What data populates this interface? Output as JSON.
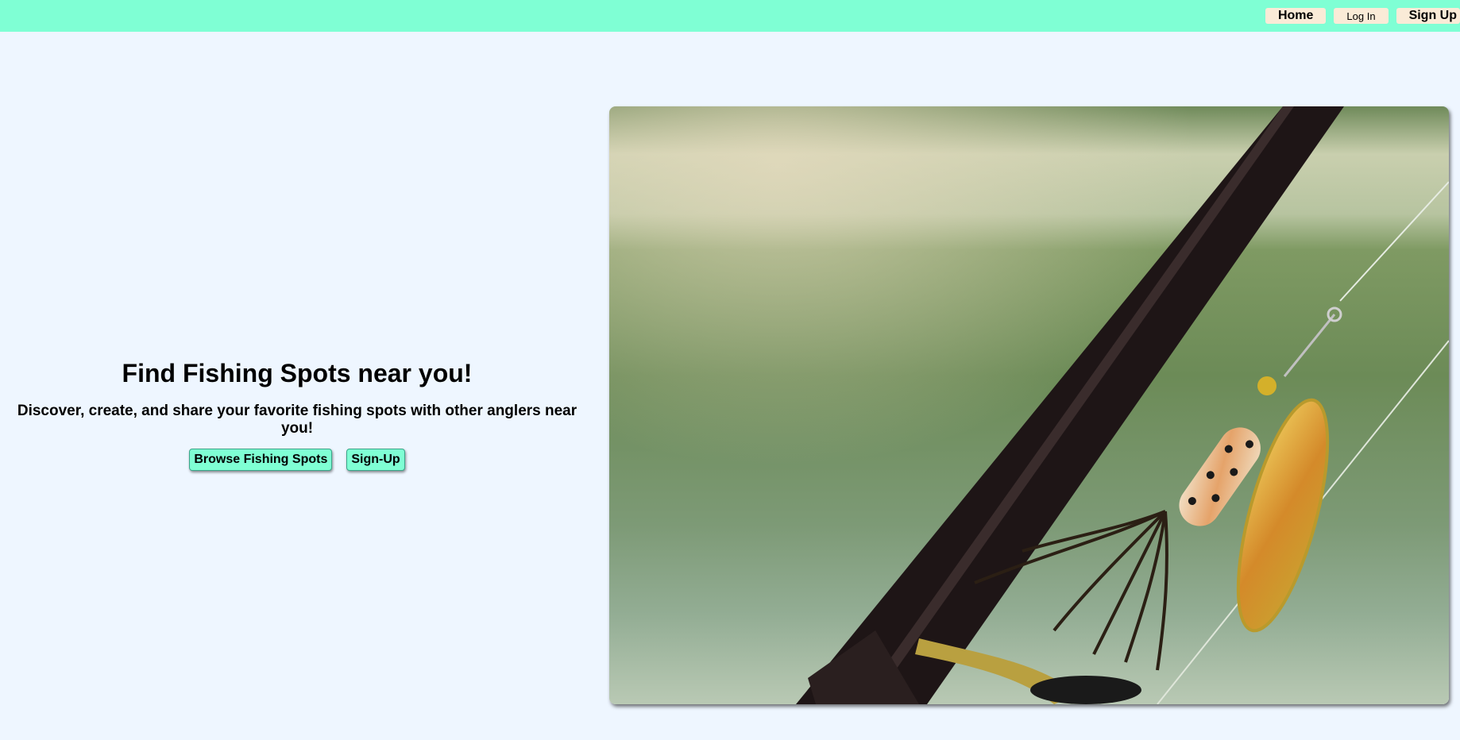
{
  "nav": {
    "home_label": "Home",
    "login_label": "Log In",
    "signup_label": "Sign Up"
  },
  "hero": {
    "title": "Find Fishing Spots near you!",
    "subtitle": "Discover, create, and share your favorite fishing spots with other anglers near you!",
    "browse_button": "Browse Fishing Spots",
    "signup_button": "Sign-Up"
  },
  "colors": {
    "topbar": "#7fffd4",
    "nav_button": "#faebd7",
    "page_background": "#eef6ff",
    "hero_button": "#7fffd4"
  }
}
